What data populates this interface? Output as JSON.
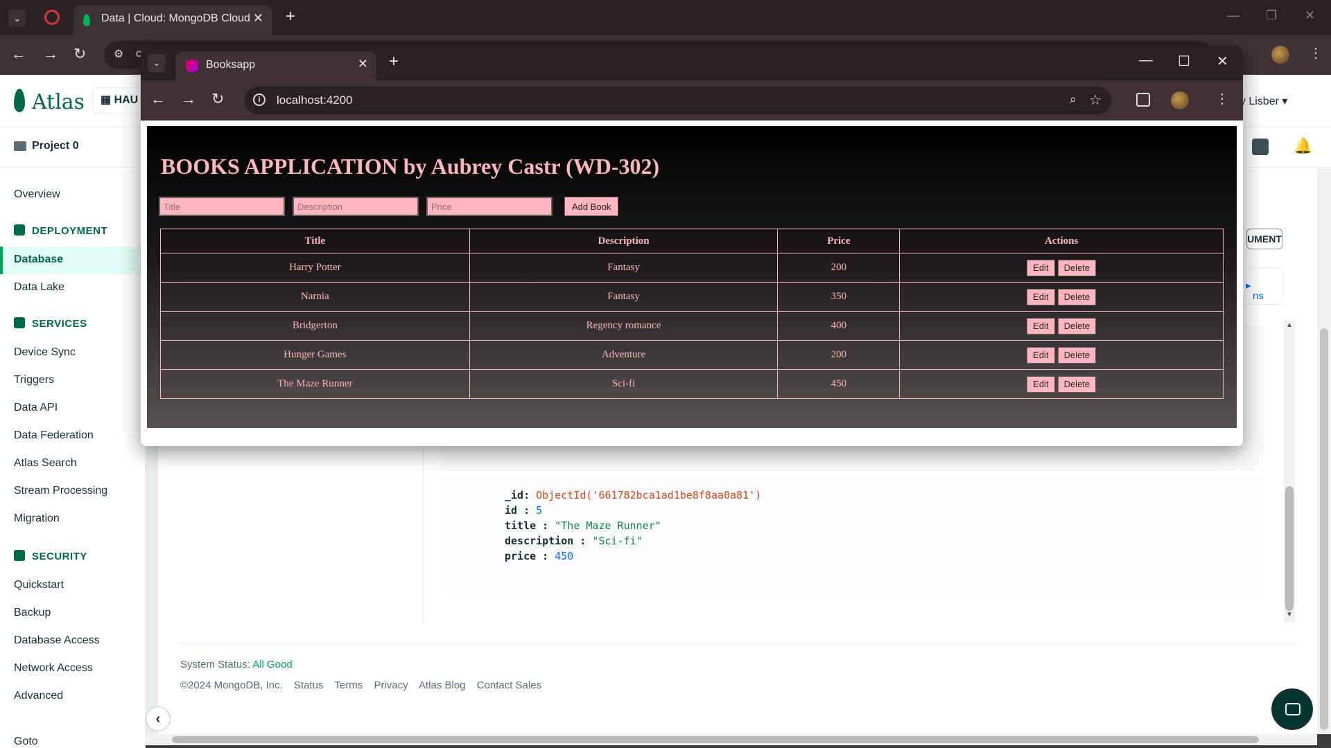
{
  "background_browser": {
    "tab_title": "Data | Cloud: MongoDB Cloud",
    "address_partial": "c",
    "atlas": {
      "logo_text": "Atlas",
      "org_name": "HAU",
      "user_name": "ey Lisber",
      "project_name": "Project 0",
      "sidebar": {
        "overview": "Overview",
        "deployment_header": "DEPLOYMENT",
        "database": "Database",
        "data_lake": "Data Lake",
        "services_header": "SERVICES",
        "device_sync": "Device Sync",
        "triggers": "Triggers",
        "data_api": "Data API",
        "data_federation": "Data Federation",
        "atlas_search": "Atlas Search",
        "stream_processing": "Stream Processing",
        "migration": "Migration",
        "security_header": "SECURITY",
        "quickstart": "Quickstart",
        "backup": "Backup",
        "database_access": "Database Access",
        "network_access": "Network Access",
        "advanced": "Advanced",
        "goto": "Goto"
      },
      "insert_document_partial": "UMENT",
      "link_partial": "ns",
      "document": {
        "id_key": "_id",
        "id_value": "ObjectId('661782bca1ad1be8f8aa0a81')",
        "idnum_key": "id",
        "idnum_value": "5",
        "title_key": "title",
        "title_value": "\"The Maze Runner\"",
        "description_key": "description",
        "description_value": "\"Sci-fi\"",
        "price_key": "price",
        "price_value": "450"
      },
      "footer": {
        "status_label": "System Status:",
        "status_value": "All Good",
        "copyright": "©2024 MongoDB, Inc.",
        "links": [
          "Status",
          "Terms",
          "Privacy",
          "Atlas Blog",
          "Contact Sales"
        ]
      }
    }
  },
  "foreground_browser": {
    "tab_title": "Booksapp",
    "url": "localhost:4200",
    "app": {
      "title": "BOOKS APPLICATION by Aubrey Castr (WD-302)",
      "form": {
        "title_placeholder": "Title",
        "description_placeholder": "Description",
        "price_placeholder": "Price",
        "add_button": "Add Book"
      },
      "table": {
        "headers": [
          "Title",
          "Description",
          "Price",
          "Actions"
        ],
        "edit_label": "Edit",
        "delete_label": "Delete",
        "rows": [
          {
            "title": "Harry Potter",
            "description": "Fantasy",
            "price": "200"
          },
          {
            "title": "Narnia",
            "description": "Fantasy",
            "price": "350"
          },
          {
            "title": "Bridgerton",
            "description": "Regency romance",
            "price": "400"
          },
          {
            "title": "Hunger Games",
            "description": "Adventure",
            "price": "200"
          },
          {
            "title": "The Maze Runner",
            "description": "Sci-fi",
            "price": "450"
          }
        ]
      }
    }
  },
  "colors": {
    "app_accent": "#ffb6c1",
    "atlas_green": "#00684a",
    "status_good": "#00a35c"
  }
}
